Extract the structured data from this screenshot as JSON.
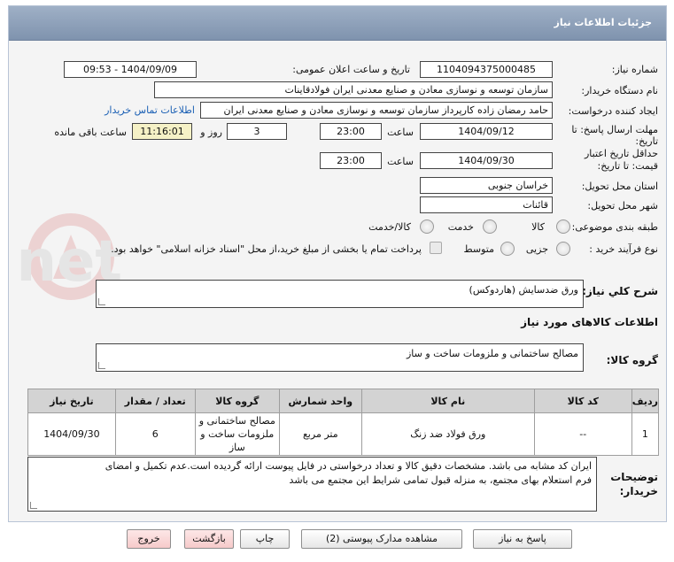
{
  "header": {
    "title": "جزئیات اطلاعات نیاز"
  },
  "fields": {
    "need_number_label": "شماره نیاز:",
    "need_number": "1104094375000485",
    "announce_label": "تاریخ و ساعت اعلان عمومی:",
    "announce_value": "1404/09/09 - 09:53",
    "buyer_org_label": "نام دستگاه خریدار:",
    "buyer_org": "سازمان توسعه و نوسازی معادن و صنایع معدنی ایران فولادقاینات",
    "requester_label": "ایجاد کننده درخواست:",
    "requester": "حامد  رمضان زاده  کارپرداز  سازمان توسعه و نوسازی معادن و صنایع معدنی ایران",
    "contact_link": "اطلاعات تماس خریدار",
    "deadline_label_1": "مهلت ارسال پاسخ: تا",
    "deadline_label_2": "تاریخ:",
    "deadline_date": "1404/09/12",
    "time_label": "ساعت",
    "deadline_time": "23:00",
    "days_value": "3",
    "days_label": "روز و",
    "remaining_time": "11:16:01",
    "remaining_label": "ساعت باقی مانده",
    "validity_label_1": "حداقل تاریخ اعتبار",
    "validity_label_2": "قیمت: تا تاریخ:",
    "validity_date": "1404/09/30",
    "validity_time": "23:00",
    "province_label": "استان محل تحویل:",
    "province": "خراسان جنوبی",
    "city_label": "شهر محل تحویل:",
    "city": "قائنات",
    "category_label": "طبقه بندی موضوعی:",
    "category_options": [
      "کالا",
      "خدمت",
      "کالا/خدمت"
    ],
    "process_label": "نوع فرآیند خرید :",
    "process_options": [
      "جزیی",
      "متوسط"
    ],
    "payment_note": "پرداخت تمام یا بخشی از مبلغ خرید،از محل \"اسناد خزانه اسلامی\" خواهد بود."
  },
  "summary": {
    "label": "شرح کلي نياز:",
    "value": "ورق ضدسایش (هاردوکس)"
  },
  "goods_info": {
    "title": "اطلاعات کالاهای مورد نیاز",
    "group_label": "گروه کالا:",
    "group_value": "مصالح ساختمانی و ملزومات ساخت و ساز"
  },
  "table": {
    "headers": [
      "ردیف",
      "کد کالا",
      "نام کالا",
      "واحد شمارش",
      "گروه کالا",
      "تعداد / مقدار",
      "تاریخ نیاز"
    ],
    "rows": [
      {
        "row": "1",
        "code": "--",
        "name": "ورق فولاد ضد زنگ",
        "unit": "متر مربع",
        "group": "مصالح ساختمانی و ملزومات ساخت و ساز",
        "qty": "6",
        "date": "1404/09/30"
      }
    ]
  },
  "buyer_notes": {
    "label_1": "توضیحات",
    "label_2": "خریدار:",
    "line_1": "ایران کد مشابه می باشد. مشخصات دقیق کالا و تعداد درخواستی در فایل پیوست ارائه گردیده است.عدم تکمیل و امضای",
    "line_2": "فرم استعلام بهای مجتمع، به منزله قبول تمامی شرایط این مجتمع می باشد"
  },
  "buttons": {
    "reply": "پاسخ به نیاز",
    "view_docs": "مشاهده مدارک پیوستی (2)",
    "print": "چاپ",
    "back": "بازگشت",
    "exit": "خروج"
  },
  "watermark_text": "AriaTender.net"
}
